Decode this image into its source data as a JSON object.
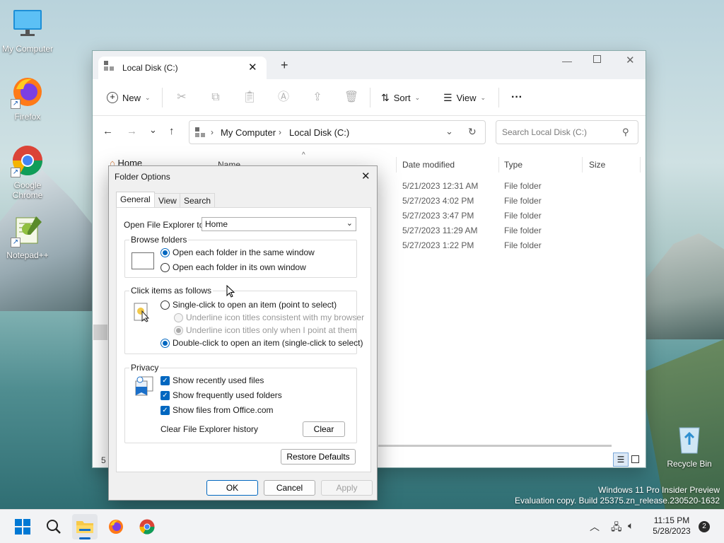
{
  "desktop": {
    "icons": [
      {
        "label": "My Computer",
        "icon": "monitor-icon"
      },
      {
        "label": "Firefox",
        "icon": "firefox-icon"
      },
      {
        "label": "Google Chrome",
        "icon": "chrome-icon"
      },
      {
        "label": "Notepad++",
        "icon": "notepadpp-icon"
      },
      {
        "label": "Recycle Bin",
        "icon": "recycle-bin-icon"
      }
    ],
    "watermark_line1": "Windows 11 Pro Insider Preview",
    "watermark_line2": "Evaluation copy. Build 25375.zn_release.230520-1632"
  },
  "explorer": {
    "tab_title": "Local Disk (C:)",
    "toolbar": {
      "new_label": "New",
      "sort_label": "Sort",
      "view_label": "View",
      "more_label": "···"
    },
    "breadcrumb": [
      "My Computer",
      "Local Disk (C:)"
    ],
    "search_placeholder": "Search Local Disk (C:)",
    "nav_home": "Home",
    "columns": {
      "name": "Name",
      "date": "Date modified",
      "type": "Type",
      "size": "Size"
    },
    "rows": [
      {
        "date": "5/21/2023 12:31 AM",
        "type": "File folder"
      },
      {
        "date": "5/27/2023 4:02 PM",
        "type": "File folder"
      },
      {
        "date": "5/27/2023 3:47 PM",
        "type": "File folder"
      },
      {
        "date": "5/27/2023 11:29 AM",
        "type": "File folder"
      },
      {
        "date": "5/27/2023 1:22 PM",
        "type": "File folder"
      }
    ],
    "status_count": "5"
  },
  "dialog": {
    "title": "Folder Options",
    "tabs": [
      "General",
      "View",
      "Search"
    ],
    "open_explorer_label": "Open File Explorer to:",
    "open_explorer_value": "Home",
    "browse": {
      "legend": "Browse folders",
      "opt_same": "Open each folder in the same window",
      "opt_own": "Open each folder in its own window"
    },
    "click": {
      "legend": "Click items as follows",
      "opt_single": "Single-click to open an item (point to select)",
      "opt_underline_browser": "Underline icon titles consistent with my browser",
      "opt_underline_point": "Underline icon titles only when I point at them",
      "opt_double": "Double-click to open an item (single-click to select)"
    },
    "privacy": {
      "legend": "Privacy",
      "recent_files": "Show recently used files",
      "frequent_folders": "Show frequently used folders",
      "office_files": "Show files from Office.com",
      "clear_label": "Clear File Explorer history",
      "clear_button": "Clear"
    },
    "restore_defaults": "Restore Defaults",
    "ok": "OK",
    "cancel": "Cancel",
    "apply": "Apply"
  },
  "taskbar": {
    "time": "11:15 PM",
    "date": "5/28/2023",
    "notification_count": "2"
  },
  "colors": {
    "accent": "#0067c0",
    "taskbar": "#f2f3f5",
    "dialog_bg": "#f0f0f0"
  }
}
